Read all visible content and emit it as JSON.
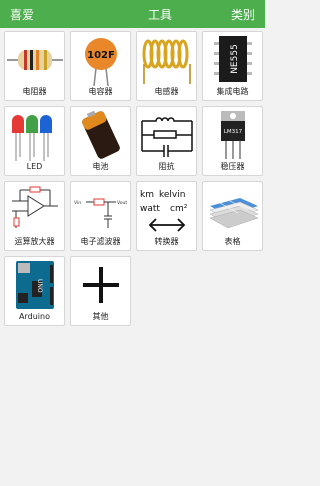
{
  "header": {
    "left": "喜爱",
    "title": "工具",
    "right": "类别",
    "accent_color": "#4cae4c"
  },
  "tools": [
    {
      "label": "电阻器",
      "icon": "resistor-icon"
    },
    {
      "label": "电容器",
      "icon": "capacitor-icon",
      "icon_text": "102F"
    },
    {
      "label": "电感器",
      "icon": "inductor-icon"
    },
    {
      "label": "集成电路",
      "icon": "ic-chip-icon",
      "icon_text": "NE555"
    },
    {
      "label": "LED",
      "icon": "led-icon"
    },
    {
      "label": "电池",
      "icon": "battery-icon"
    },
    {
      "label": "阻抗",
      "icon": "impedance-icon"
    },
    {
      "label": "稳压器",
      "icon": "voltage-regulator-icon",
      "icon_text": "LM317"
    },
    {
      "label": "运算放大器",
      "icon": "op-amp-icon"
    },
    {
      "label": "电子滤波器",
      "icon": "filter-icon"
    },
    {
      "label": "转换器",
      "icon": "converter-icon",
      "icon_text": [
        "km",
        "kelvin",
        "watt",
        "cm²"
      ]
    },
    {
      "label": "表格",
      "icon": "table-icon"
    },
    {
      "label": "Arduino",
      "icon": "arduino-icon",
      "icon_text": "UNO"
    },
    {
      "label": "其他",
      "icon": "plus-icon"
    }
  ]
}
